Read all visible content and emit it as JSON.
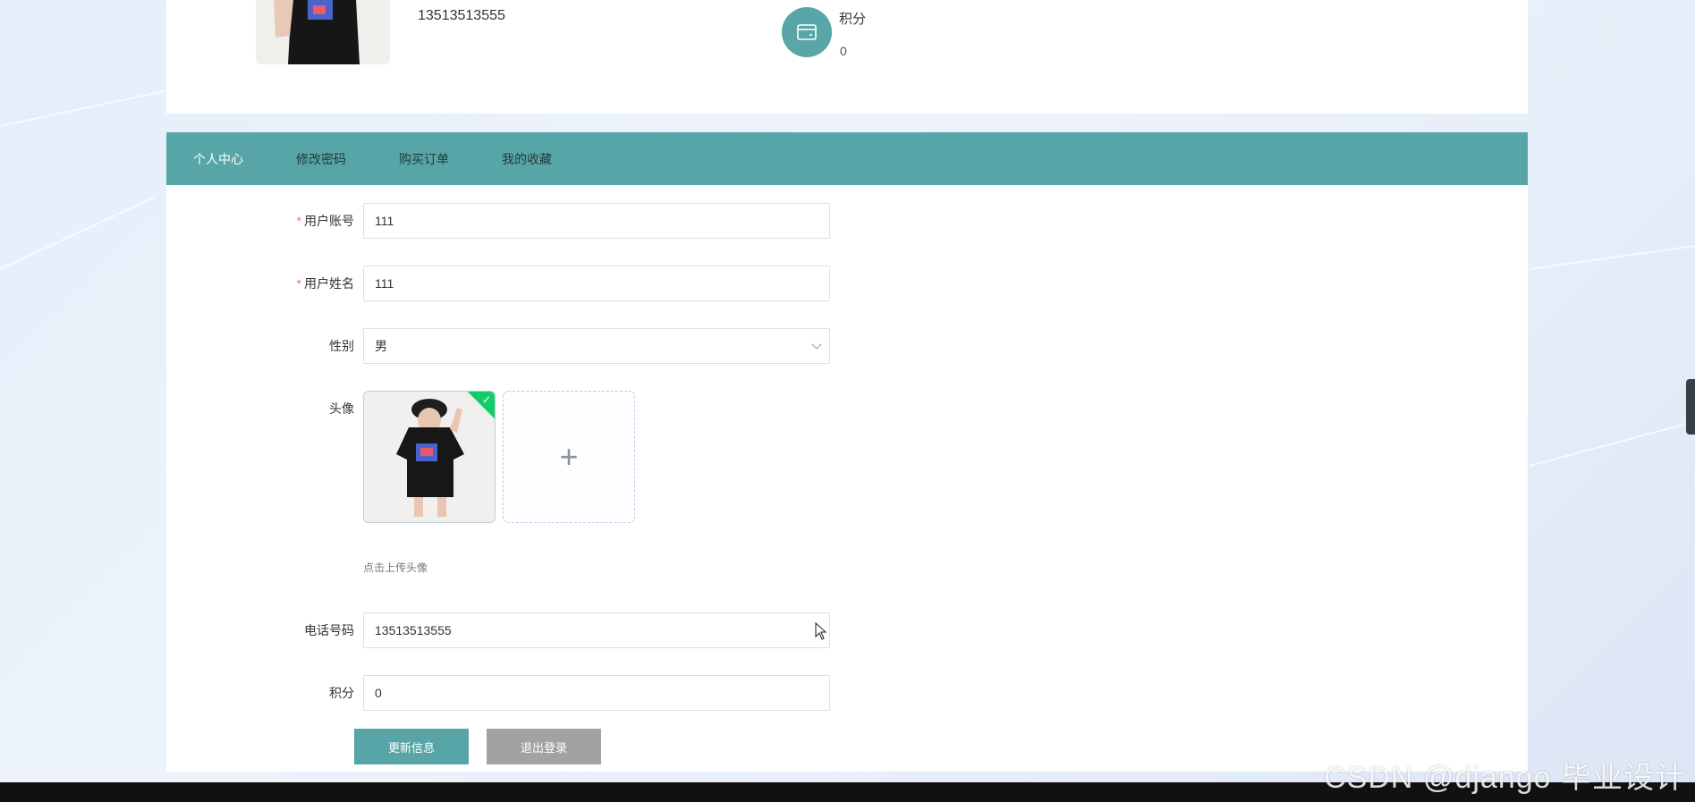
{
  "profile": {
    "phone": "13513513555",
    "points_label": "积分",
    "points_value": "0",
    "points_icon": "wallet-icon"
  },
  "tabs": [
    {
      "label": "个人中心",
      "active": true
    },
    {
      "label": "修改密码",
      "active": false
    },
    {
      "label": "购买订单",
      "active": false
    },
    {
      "label": "我的收藏",
      "active": false
    }
  ],
  "form": {
    "account_label": "用户账号",
    "account_value": "111",
    "name_label": "用户姓名",
    "name_value": "111",
    "gender_label": "性别",
    "gender_value": "男",
    "avatar_label": "头像",
    "avatar_hint": "点击上传头像",
    "phone_label": "电话号码",
    "phone_value": "13513513555",
    "points_label": "积分",
    "points_value": "0",
    "required_mark": "*"
  },
  "buttons": {
    "update": "更新信息",
    "logout": "退出登录"
  },
  "watermark": "CSDN @django 毕业设计",
  "colors": {
    "accent": "#58a5a7",
    "logout_button": "#a2a2a2",
    "required": "#f56c6c",
    "success": "#13ce66"
  }
}
